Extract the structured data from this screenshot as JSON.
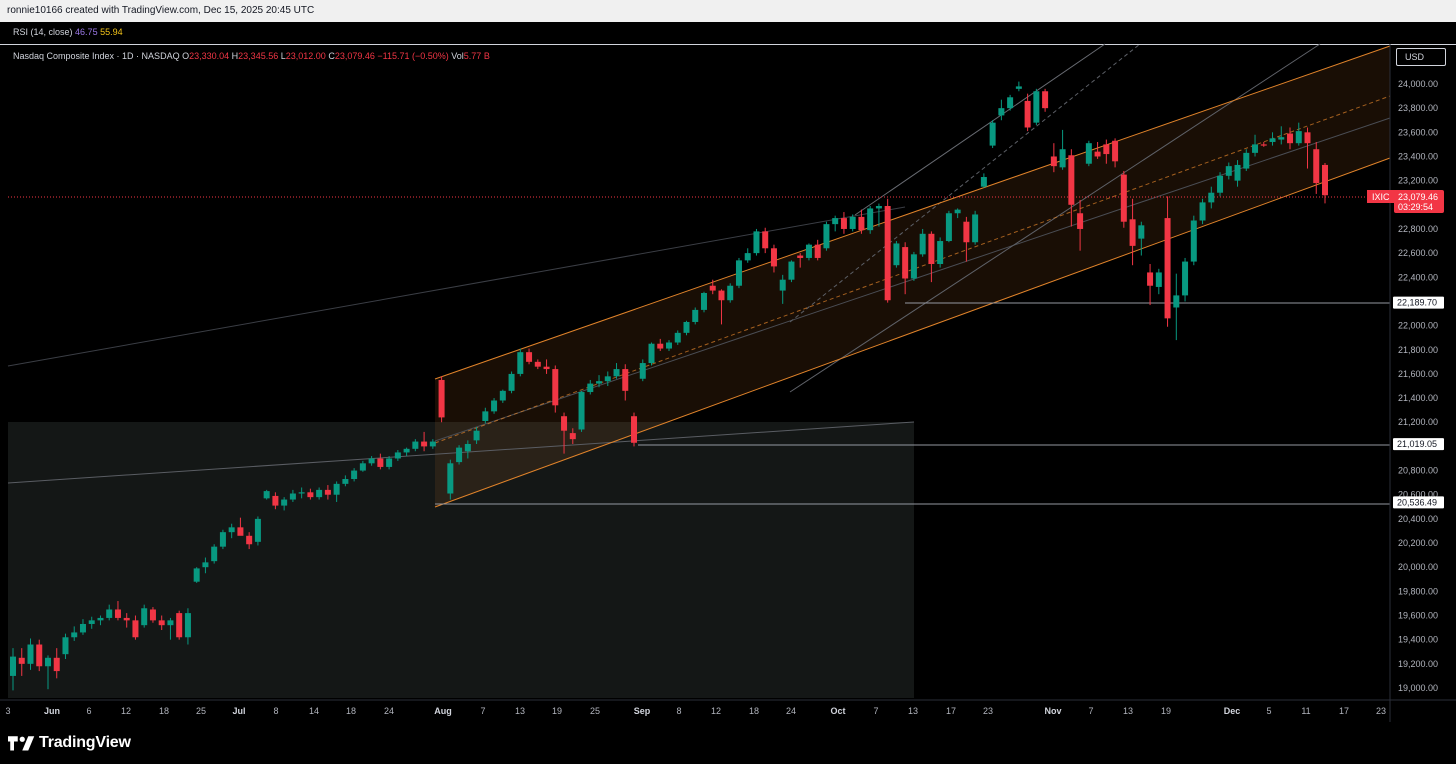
{
  "header": {
    "created_by": "ronnie10166 created with TradingView.com, Dec 15, 2025 20:45 UTC"
  },
  "rsi": {
    "label": "RSI (14, close)",
    "value1": "46.75",
    "value2": "55.94"
  },
  "legend": {
    "symbol": "Nasdaq Composite Index · 1D · NASDAQ",
    "o_key": "O",
    "o_val": "23,330.04",
    "h_key": "H",
    "h_val": "23,345.56",
    "l_key": "L",
    "l_val": "23,012.00",
    "c_key": "C",
    "c_val": "23,079.46",
    "change": "−115.71 (−0.50%)",
    "vol_key": "Vol",
    "vol_val": "5.77 B"
  },
  "currency_button": "USD",
  "price_axis": {
    "ticks": [
      "24,000.00",
      "23,800.00",
      "23,600.00",
      "23,400.00",
      "23,200.00",
      "22,800.00",
      "22,600.00",
      "22,400.00",
      "22,000.00",
      "21,800.00",
      "21,600.00",
      "21,400.00",
      "21,200.00",
      "20,800.00",
      "20,600.00",
      "20,400.00",
      "20,200.00",
      "20,000.00",
      "19,800.00",
      "19,600.00",
      "19,400.00",
      "19,200.00",
      "19,000.00"
    ],
    "current_symbol": "IXIC",
    "current_price": "23,079.46",
    "countdown": "03:29:54",
    "level_labels": [
      "22,189.70",
      "21,019.05",
      "20,536.49"
    ]
  },
  "time_axis": {
    "labels": [
      "3",
      "Jun",
      "6",
      "12",
      "18",
      "25",
      "Jul",
      "8",
      "14",
      "18",
      "24",
      "Aug",
      "7",
      "13",
      "19",
      "25",
      "Sep",
      "8",
      "12",
      "18",
      "24",
      "Oct",
      "7",
      "13",
      "17",
      "23",
      "Nov",
      "7",
      "13",
      "19",
      "Dec",
      "5",
      "11",
      "17",
      "23"
    ]
  },
  "colors": {
    "up": "#089981",
    "down": "#f23645",
    "channel": "#e0832a",
    "background": "#000000"
  },
  "chart_data": {
    "type": "candlestick",
    "symbol": "IXIC",
    "ylim": [
      18900,
      24300
    ],
    "candles": [
      {
        "o": 19100,
        "h": 19330,
        "l": 18980,
        "c": 19260
      },
      {
        "o": 19250,
        "h": 19330,
        "l": 19100,
        "c": 19200
      },
      {
        "o": 19200,
        "h": 19410,
        "l": 19150,
        "c": 19360
      },
      {
        "o": 19360,
        "h": 19400,
        "l": 19140,
        "c": 19180
      },
      {
        "o": 19180,
        "h": 19270,
        "l": 18990,
        "c": 19250
      },
      {
        "o": 19250,
        "h": 19330,
        "l": 19080,
        "c": 19140
      },
      {
        "o": 19280,
        "h": 19450,
        "l": 19240,
        "c": 19420
      },
      {
        "o": 19420,
        "h": 19510,
        "l": 19390,
        "c": 19460
      },
      {
        "o": 19460,
        "h": 19570,
        "l": 19440,
        "c": 19530
      },
      {
        "o": 19530,
        "h": 19590,
        "l": 19490,
        "c": 19560
      },
      {
        "o": 19560,
        "h": 19600,
        "l": 19520,
        "c": 19580
      },
      {
        "o": 19580,
        "h": 19690,
        "l": 19560,
        "c": 19650
      },
      {
        "o": 19650,
        "h": 19720,
        "l": 19560,
        "c": 19580
      },
      {
        "o": 19580,
        "h": 19620,
        "l": 19500,
        "c": 19560
      },
      {
        "o": 19560,
        "h": 19600,
        "l": 19400,
        "c": 19420
      },
      {
        "o": 19520,
        "h": 19690,
        "l": 19500,
        "c": 19660
      },
      {
        "o": 19650,
        "h": 19670,
        "l": 19540,
        "c": 19560
      },
      {
        "o": 19560,
        "h": 19600,
        "l": 19480,
        "c": 19520
      },
      {
        "o": 19520,
        "h": 19580,
        "l": 19400,
        "c": 19560
      },
      {
        "o": 19620,
        "h": 19640,
        "l": 19400,
        "c": 19420
      },
      {
        "o": 19420,
        "h": 19660,
        "l": 19360,
        "c": 19620
      },
      {
        "o": 19880,
        "h": 20000,
        "l": 19870,
        "c": 19990
      },
      {
        "o": 20000,
        "h": 20080,
        "l": 19950,
        "c": 20040
      },
      {
        "o": 20050,
        "h": 20190,
        "l": 20030,
        "c": 20170
      },
      {
        "o": 20170,
        "h": 20310,
        "l": 20150,
        "c": 20290
      },
      {
        "o": 20290,
        "h": 20360,
        "l": 20240,
        "c": 20330
      },
      {
        "o": 20330,
        "h": 20410,
        "l": 20290,
        "c": 20260
      },
      {
        "o": 20260,
        "h": 20290,
        "l": 20150,
        "c": 20190
      },
      {
        "o": 20210,
        "h": 20420,
        "l": 20180,
        "c": 20400
      },
      {
        "o": 20570,
        "h": 20640,
        "l": 20560,
        "c": 20630
      },
      {
        "o": 20590,
        "h": 20620,
        "l": 20480,
        "c": 20510
      },
      {
        "o": 20510,
        "h": 20580,
        "l": 20470,
        "c": 20560
      },
      {
        "o": 20560,
        "h": 20640,
        "l": 20540,
        "c": 20610
      },
      {
        "o": 20610,
        "h": 20660,
        "l": 20570,
        "c": 20620
      },
      {
        "o": 20620,
        "h": 20650,
        "l": 20560,
        "c": 20580
      },
      {
        "o": 20580,
        "h": 20660,
        "l": 20560,
        "c": 20640
      },
      {
        "o": 20640,
        "h": 20680,
        "l": 20560,
        "c": 20600
      },
      {
        "o": 20600,
        "h": 20710,
        "l": 20540,
        "c": 20690
      },
      {
        "o": 20690,
        "h": 20760,
        "l": 20670,
        "c": 20730
      },
      {
        "o": 20730,
        "h": 20820,
        "l": 20710,
        "c": 20800
      },
      {
        "o": 20800,
        "h": 20880,
        "l": 20790,
        "c": 20860
      },
      {
        "o": 20860,
        "h": 20920,
        "l": 20840,
        "c": 20900
      },
      {
        "o": 20900,
        "h": 20940,
        "l": 20810,
        "c": 20830
      },
      {
        "o": 20830,
        "h": 20920,
        "l": 20810,
        "c": 20900
      },
      {
        "o": 20900,
        "h": 20970,
        "l": 20880,
        "c": 20950
      },
      {
        "o": 20950,
        "h": 20990,
        "l": 20920,
        "c": 20980
      },
      {
        "o": 20980,
        "h": 21060,
        "l": 20960,
        "c": 21040
      },
      {
        "o": 21040,
        "h": 21120,
        "l": 20960,
        "c": 21000
      },
      {
        "o": 21000,
        "h": 21060,
        "l": 20980,
        "c": 21040
      },
      {
        "o": 21550,
        "h": 21580,
        "l": 21200,
        "c": 21240
      },
      {
        "o": 20610,
        "h": 20890,
        "l": 20560,
        "c": 20860
      },
      {
        "o": 20870,
        "h": 21010,
        "l": 20850,
        "c": 20990
      },
      {
        "o": 20960,
        "h": 21050,
        "l": 20900,
        "c": 21020
      },
      {
        "o": 21050,
        "h": 21160,
        "l": 21020,
        "c": 21130
      },
      {
        "o": 21210,
        "h": 21320,
        "l": 21190,
        "c": 21290
      },
      {
        "o": 21290,
        "h": 21400,
        "l": 21270,
        "c": 21380
      },
      {
        "o": 21380,
        "h": 21470,
        "l": 21360,
        "c": 21460
      },
      {
        "o": 21460,
        "h": 21620,
        "l": 21440,
        "c": 21600
      },
      {
        "o": 21600,
        "h": 21810,
        "l": 21580,
        "c": 21780
      },
      {
        "o": 21780,
        "h": 21810,
        "l": 21680,
        "c": 21700
      },
      {
        "o": 21700,
        "h": 21720,
        "l": 21640,
        "c": 21660
      },
      {
        "o": 21660,
        "h": 21720,
        "l": 21600,
        "c": 21640
      },
      {
        "o": 21640,
        "h": 21670,
        "l": 21280,
        "c": 21340
      },
      {
        "o": 21250,
        "h": 21280,
        "l": 20940,
        "c": 21130
      },
      {
        "o": 21110,
        "h": 21150,
        "l": 21020,
        "c": 21060
      },
      {
        "o": 21140,
        "h": 21460,
        "l": 21120,
        "c": 21450
      },
      {
        "o": 21450,
        "h": 21550,
        "l": 21430,
        "c": 21520
      },
      {
        "o": 21520,
        "h": 21590,
        "l": 21490,
        "c": 21540
      },
      {
        "o": 21540,
        "h": 21620,
        "l": 21500,
        "c": 21580
      },
      {
        "o": 21580,
        "h": 21690,
        "l": 21560,
        "c": 21640
      },
      {
        "o": 21640,
        "h": 21680,
        "l": 21380,
        "c": 21460
      },
      {
        "o": 21250,
        "h": 21280,
        "l": 21000,
        "c": 21030
      },
      {
        "o": 21560,
        "h": 21720,
        "l": 21540,
        "c": 21690
      },
      {
        "o": 21690,
        "h": 21860,
        "l": 21670,
        "c": 21850
      },
      {
        "o": 21850,
        "h": 21890,
        "l": 21790,
        "c": 21810
      },
      {
        "o": 21810,
        "h": 21880,
        "l": 21790,
        "c": 21860
      },
      {
        "o": 21860,
        "h": 21960,
        "l": 21840,
        "c": 21940
      },
      {
        "o": 21940,
        "h": 22040,
        "l": 21920,
        "c": 22030
      },
      {
        "o": 22030,
        "h": 22150,
        "l": 22010,
        "c": 22130
      },
      {
        "o": 22130,
        "h": 22280,
        "l": 22110,
        "c": 22270
      },
      {
        "o": 22330,
        "h": 22380,
        "l": 22260,
        "c": 22290
      },
      {
        "o": 22290,
        "h": 22300,
        "l": 22010,
        "c": 22210
      },
      {
        "o": 22210,
        "h": 22350,
        "l": 22190,
        "c": 22330
      },
      {
        "o": 22330,
        "h": 22560,
        "l": 22310,
        "c": 22540
      },
      {
        "o": 22540,
        "h": 22640,
        "l": 22520,
        "c": 22600
      },
      {
        "o": 22600,
        "h": 22800,
        "l": 22580,
        "c": 22780
      },
      {
        "o": 22780,
        "h": 22810,
        "l": 22600,
        "c": 22640
      },
      {
        "o": 22640,
        "h": 22670,
        "l": 22440,
        "c": 22490
      },
      {
        "o": 22290,
        "h": 22420,
        "l": 22180,
        "c": 22380
      },
      {
        "o": 22380,
        "h": 22540,
        "l": 22360,
        "c": 22530
      },
      {
        "o": 22580,
        "h": 22600,
        "l": 22480,
        "c": 22560
      },
      {
        "o": 22560,
        "h": 22680,
        "l": 22540,
        "c": 22670
      },
      {
        "o": 22670,
        "h": 22710,
        "l": 22540,
        "c": 22560
      },
      {
        "o": 22640,
        "h": 22860,
        "l": 22620,
        "c": 22840
      },
      {
        "o": 22840,
        "h": 22910,
        "l": 22780,
        "c": 22890
      },
      {
        "o": 22890,
        "h": 22940,
        "l": 22760,
        "c": 22800
      },
      {
        "o": 22800,
        "h": 22920,
        "l": 22780,
        "c": 22900
      },
      {
        "o": 22900,
        "h": 22960,
        "l": 22760,
        "c": 22790
      },
      {
        "o": 22790,
        "h": 22990,
        "l": 22760,
        "c": 22970
      },
      {
        "o": 22970,
        "h": 23010,
        "l": 22820,
        "c": 22990
      },
      {
        "o": 22990,
        "h": 23050,
        "l": 22190,
        "c": 22210
      },
      {
        "o": 22500,
        "h": 22700,
        "l": 22480,
        "c": 22680
      },
      {
        "o": 22650,
        "h": 22690,
        "l": 22260,
        "c": 22390
      },
      {
        "o": 22390,
        "h": 22610,
        "l": 22370,
        "c": 22590
      },
      {
        "o": 22590,
        "h": 22800,
        "l": 22570,
        "c": 22760
      },
      {
        "o": 22760,
        "h": 22780,
        "l": 22360,
        "c": 22510
      },
      {
        "o": 22510,
        "h": 22730,
        "l": 22480,
        "c": 22700
      },
      {
        "o": 22700,
        "h": 22950,
        "l": 22690,
        "c": 22930
      },
      {
        "o": 22930,
        "h": 22970,
        "l": 22890,
        "c": 22960
      },
      {
        "o": 22860,
        "h": 22900,
        "l": 22530,
        "c": 22690
      },
      {
        "o": 22690,
        "h": 22950,
        "l": 22670,
        "c": 22920
      },
      {
        "o": 23150,
        "h": 23260,
        "l": 23140,
        "c": 23230
      },
      {
        "o": 23490,
        "h": 23700,
        "l": 23470,
        "c": 23680
      },
      {
        "o": 23740,
        "h": 23870,
        "l": 23700,
        "c": 23800
      },
      {
        "o": 23800,
        "h": 23910,
        "l": 23780,
        "c": 23890
      },
      {
        "o": 23960,
        "h": 24020,
        "l": 23940,
        "c": 23980
      },
      {
        "o": 23860,
        "h": 23920,
        "l": 23610,
        "c": 23640
      },
      {
        "o": 23680,
        "h": 23960,
        "l": 23660,
        "c": 23940
      },
      {
        "o": 23940,
        "h": 23960,
        "l": 23770,
        "c": 23800
      },
      {
        "o": 23400,
        "h": 23510,
        "l": 23270,
        "c": 23320
      },
      {
        "o": 23310,
        "h": 23620,
        "l": 23290,
        "c": 23460
      },
      {
        "o": 23410,
        "h": 23460,
        "l": 22820,
        "c": 23000
      },
      {
        "o": 22930,
        "h": 23040,
        "l": 22620,
        "c": 22800
      },
      {
        "o": 23340,
        "h": 23530,
        "l": 23320,
        "c": 23510
      },
      {
        "o": 23440,
        "h": 23520,
        "l": 23380,
        "c": 23400
      },
      {
        "o": 23500,
        "h": 23540,
        "l": 23340,
        "c": 23420
      },
      {
        "o": 23530,
        "h": 23550,
        "l": 23310,
        "c": 23360
      },
      {
        "o": 23250,
        "h": 23280,
        "l": 22810,
        "c": 22860
      },
      {
        "o": 22880,
        "h": 23050,
        "l": 22500,
        "c": 22660
      },
      {
        "o": 22720,
        "h": 22860,
        "l": 22580,
        "c": 22830
      },
      {
        "o": 22440,
        "h": 22510,
        "l": 22170,
        "c": 22330
      },
      {
        "o": 22320,
        "h": 22470,
        "l": 22260,
        "c": 22440
      },
      {
        "o": 22890,
        "h": 23070,
        "l": 21990,
        "c": 22060
      },
      {
        "o": 22150,
        "h": 22430,
        "l": 21880,
        "c": 22250
      },
      {
        "o": 22250,
        "h": 22560,
        "l": 22200,
        "c": 22530
      },
      {
        "o": 22530,
        "h": 22910,
        "l": 22500,
        "c": 22870
      },
      {
        "o": 22870,
        "h": 23050,
        "l": 22840,
        "c": 23020
      },
      {
        "o": 23020,
        "h": 23150,
        "l": 22970,
        "c": 23100
      },
      {
        "o": 23100,
        "h": 23270,
        "l": 23070,
        "c": 23240
      },
      {
        "o": 23240,
        "h": 23350,
        "l": 23210,
        "c": 23320
      },
      {
        "o": 23200,
        "h": 23370,
        "l": 23150,
        "c": 23330
      },
      {
        "o": 23300,
        "h": 23460,
        "l": 23280,
        "c": 23430
      },
      {
        "o": 23430,
        "h": 23580,
        "l": 23400,
        "c": 23500
      },
      {
        "o": 23500,
        "h": 23520,
        "l": 23480,
        "c": 23490
      },
      {
        "o": 23520,
        "h": 23600,
        "l": 23490,
        "c": 23550
      },
      {
        "o": 23540,
        "h": 23650,
        "l": 23500,
        "c": 23560
      },
      {
        "o": 23590,
        "h": 23640,
        "l": 23460,
        "c": 23510
      },
      {
        "o": 23510,
        "h": 23680,
        "l": 23490,
        "c": 23610
      },
      {
        "o": 23600,
        "h": 23640,
        "l": 23300,
        "c": 23510
      },
      {
        "o": 23460,
        "h": 23520,
        "l": 23090,
        "c": 23180
      },
      {
        "o": 23330,
        "h": 23346,
        "l": 23012,
        "c": 23079
      }
    ]
  }
}
